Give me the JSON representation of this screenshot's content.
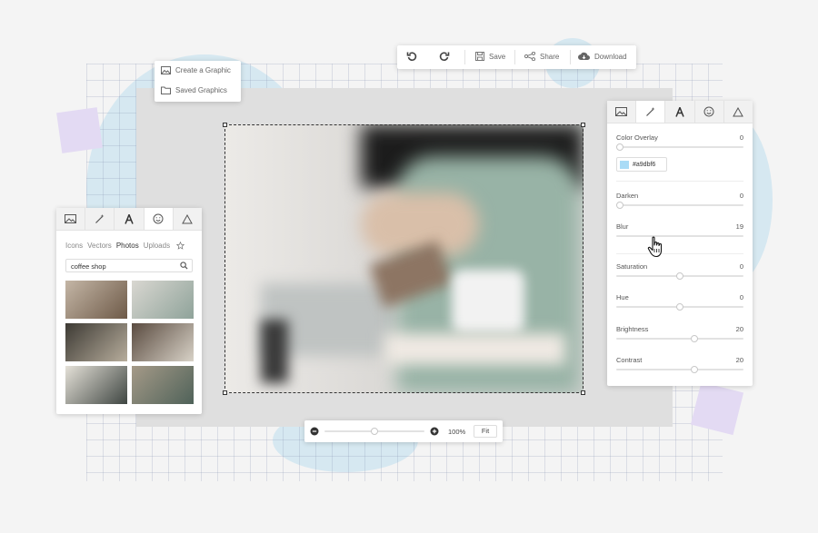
{
  "file_menu": {
    "create_label": "Create a Graphic",
    "saved_label": "Saved Graphics"
  },
  "toolbar": {
    "save_label": "Save",
    "share_label": "Share",
    "download_label": "Download"
  },
  "left_panel": {
    "tabs": [
      "Icons",
      "Vectors",
      "Photos",
      "Uploads"
    ],
    "active_tab": "Photos",
    "search_value": "coffee shop"
  },
  "right_panel": {
    "color_overlay": {
      "label": "Color Overlay",
      "value": "0",
      "hex": "#a9dbf6",
      "swatch": "#a9dbf6"
    },
    "darken": {
      "label": "Darken",
      "value": "0"
    },
    "blur": {
      "label": "Blur",
      "value": "19"
    },
    "saturation": {
      "label": "Saturation",
      "value": "0"
    },
    "hue": {
      "label": "Hue",
      "value": "0"
    },
    "brightness": {
      "label": "Brightness",
      "value": "20"
    },
    "contrast": {
      "label": "Contrast",
      "value": "20"
    }
  },
  "zoom": {
    "value": "100%",
    "fit_label": "Fit",
    "level": 0.5
  }
}
